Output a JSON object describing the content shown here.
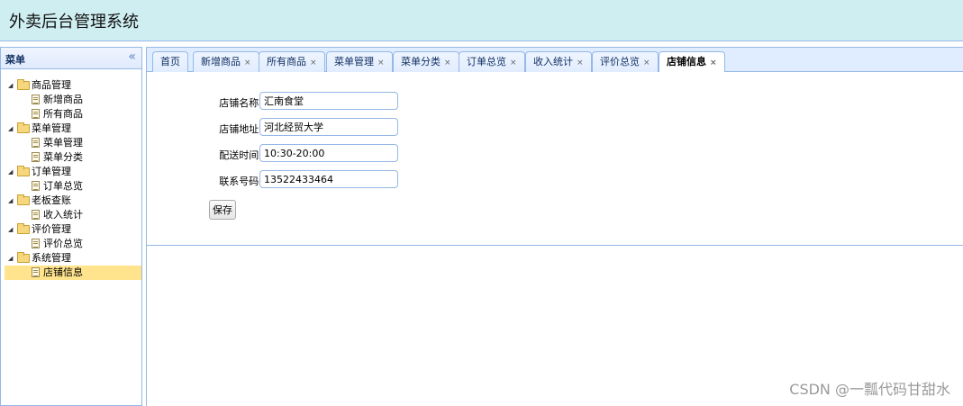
{
  "header": {
    "title": "外卖后台管理系统"
  },
  "sidebar": {
    "title": "菜单",
    "collapse_icon": "double-chevron-left-icon",
    "groups": [
      {
        "label": "商品管理",
        "items": [
          "新增商品",
          "所有商品"
        ]
      },
      {
        "label": "菜单管理",
        "items": [
          "菜单管理",
          "菜单分类"
        ]
      },
      {
        "label": "订单管理",
        "items": [
          "订单总览"
        ]
      },
      {
        "label": "老板查账",
        "items": [
          "收入统计"
        ]
      },
      {
        "label": "评价管理",
        "items": [
          "评价总览"
        ]
      },
      {
        "label": "系统管理",
        "items": [
          "店铺信息"
        ]
      }
    ],
    "selected": "店铺信息"
  },
  "tabs": [
    {
      "label": "首页",
      "closable": false
    },
    {
      "label": "新增商品",
      "closable": true
    },
    {
      "label": "所有商品",
      "closable": true
    },
    {
      "label": "菜单管理",
      "closable": true
    },
    {
      "label": "菜单分类",
      "closable": true
    },
    {
      "label": "订单总览",
      "closable": true
    },
    {
      "label": "收入统计",
      "closable": true
    },
    {
      "label": "评价总览",
      "closable": true
    },
    {
      "label": "店铺信息",
      "closable": true,
      "active": true
    }
  ],
  "close_glyph": "×",
  "form": {
    "fields": [
      {
        "label": "店铺名称:",
        "value": "汇南食堂"
      },
      {
        "label": "店铺地址:",
        "value": "河北经贸大学"
      },
      {
        "label": "配送时间:",
        "value": "10:30-20:00"
      },
      {
        "label": "联系号码:",
        "value": "13522433464"
      }
    ],
    "save_label": "保存"
  },
  "watermark": "CSDN @一瓢代码甘甜水",
  "colors": {
    "header_bg": "#cfeef1",
    "border": "#95b8e7",
    "selected_bg": "#ffe48d",
    "tabbar_bg": "#e0ecff"
  }
}
